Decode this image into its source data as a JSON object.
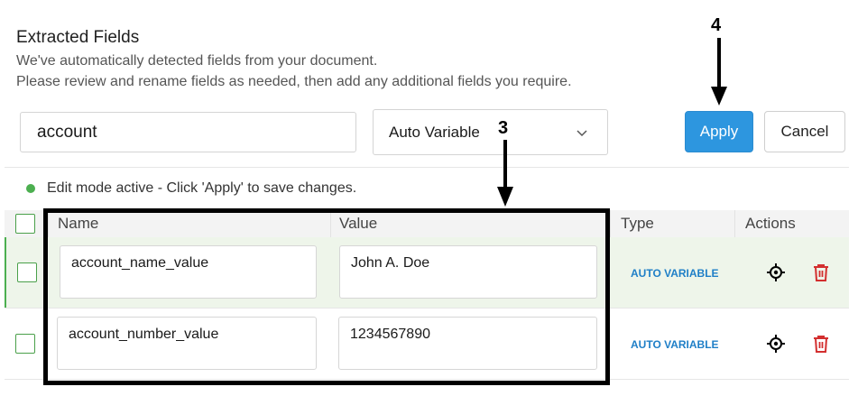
{
  "header": {
    "title": "Extracted Fields",
    "description_line1": "We've automatically detected fields from your document.",
    "description_line2": "Please review and rename fields as needed, then add any additional fields you require."
  },
  "editor": {
    "field_name_value": "account",
    "type_select_value": "Auto Variable",
    "apply_label": "Apply",
    "cancel_label": "Cancel"
  },
  "status": {
    "text": "Edit mode active - Click 'Apply' to save changes.",
    "color": "#4caf50"
  },
  "table": {
    "columns": [
      "Name",
      "Value",
      "Type",
      "Actions"
    ],
    "rows": [
      {
        "name": "account_name_value",
        "value": "John A. Doe",
        "type": "AUTO VARIABLE",
        "actions": [
          "target-icon",
          "trash-icon"
        ]
      },
      {
        "name": "account_number_value",
        "value": "1234567890",
        "type": "AUTO VARIABLE",
        "actions": [
          "target-icon",
          "trash-icon"
        ]
      }
    ]
  },
  "annotations": {
    "callout_apply": "4",
    "callout_table": "3"
  },
  "colors": {
    "accent": "#2d96df",
    "type_tag": "#1f7fc7",
    "delete": "#d32f2f",
    "selected_row": "#eef5ea"
  }
}
